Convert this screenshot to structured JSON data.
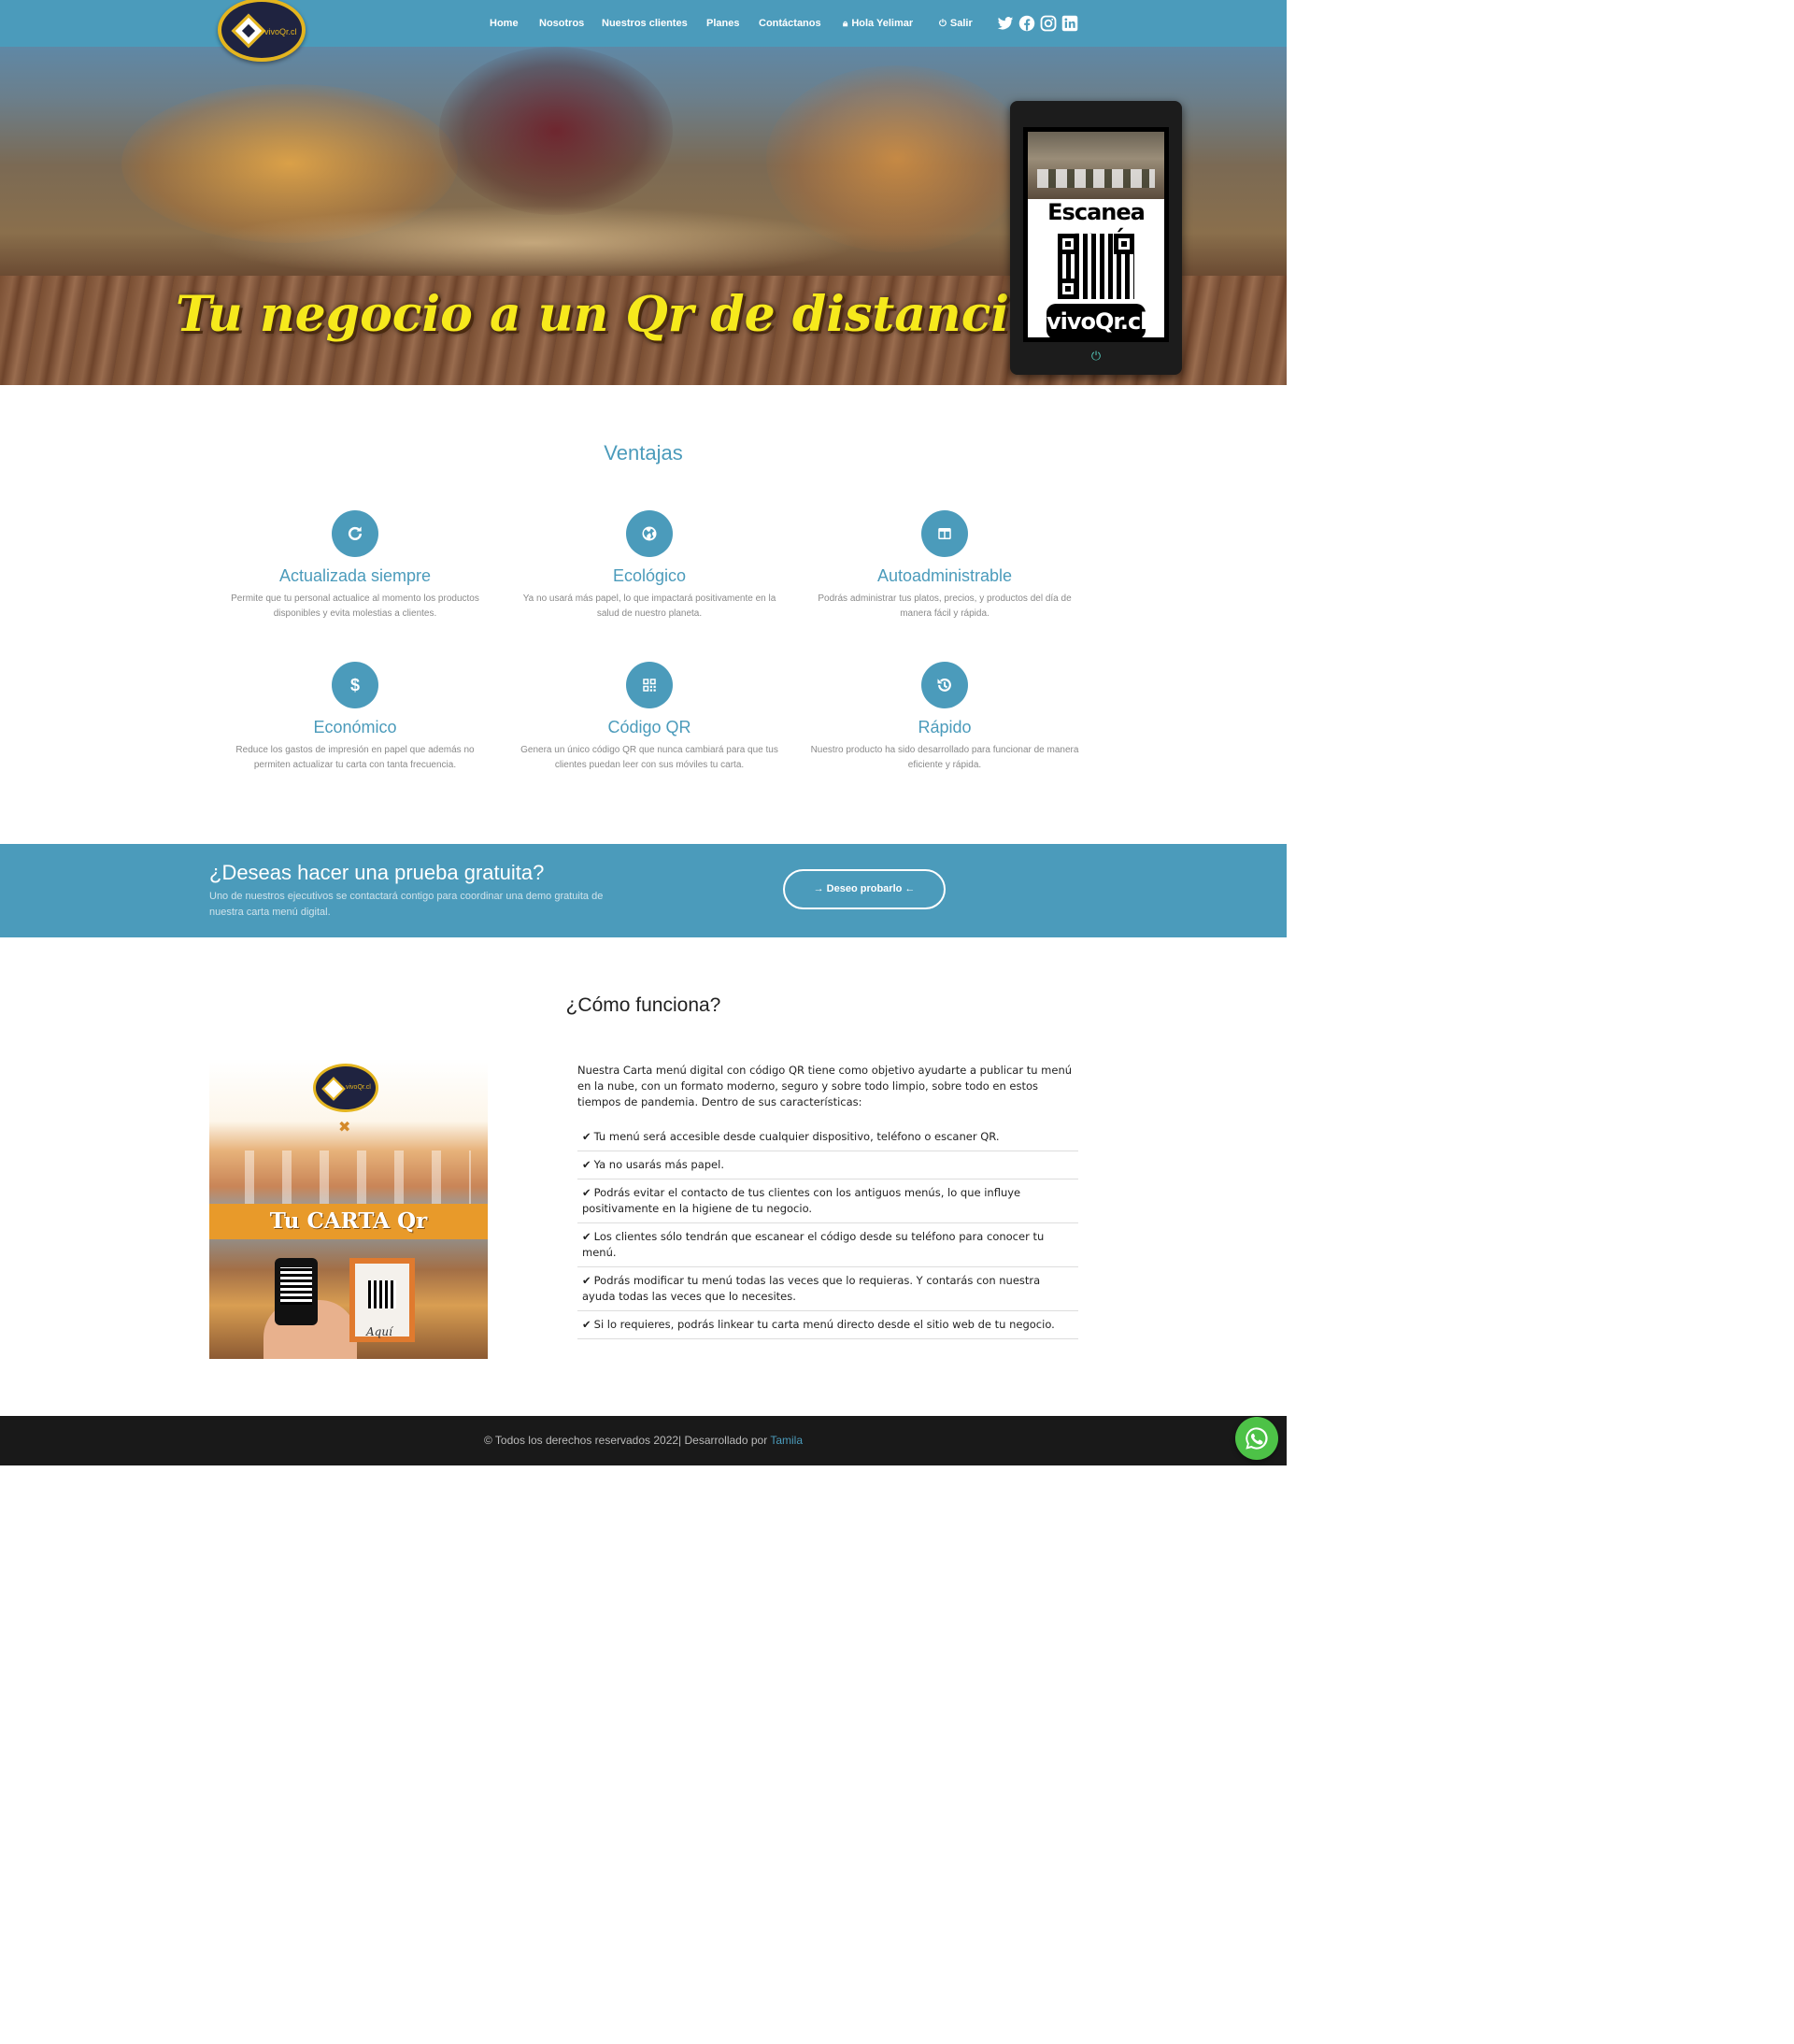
{
  "brand": {
    "logo_text": "vivoQr.cl"
  },
  "nav": {
    "home": "Home",
    "nosotros": "Nosotros",
    "clientes": "Nuestros clientes",
    "planes": "Planes",
    "contacto": "Contáctanos",
    "user": "Hola Yelimar",
    "logout": "Salir",
    "social": [
      "twitter-icon",
      "facebook-icon",
      "instagram-icon",
      "linkedin-icon"
    ]
  },
  "hero": {
    "title": "Tu negocio a un Qr de distancia",
    "tablet_scan": "Escanea aquí",
    "tablet_brand": "vivoQr.cl"
  },
  "ventajas": {
    "title": "Ventajas",
    "items": [
      {
        "icon": "refresh-icon",
        "title": "Actualizada siempre",
        "text": "Permite que tu personal actualice al momento los productos disponibles y evita molestias a clientes."
      },
      {
        "icon": "globe-icon",
        "title": "Ecológico",
        "text": "Ya no usará más papel, lo que impactará positivamente en la salud de nuestro planeta."
      },
      {
        "icon": "layout-icon",
        "title": "Autoadministrable",
        "text": "Podrás administrar tus platos, precios, y productos del día de manera fácil y rápida."
      },
      {
        "icon": "dollar-icon",
        "title": "Económico",
        "text": "Reduce los gastos de impresión en papel que además no permiten actualizar tu carta con tanta frecuencia."
      },
      {
        "icon": "qr-icon",
        "title": "Código QR",
        "text": "Genera un único código QR que nunca cambiará para que tus clientes puedan leer con sus móviles tu carta."
      },
      {
        "icon": "history-icon",
        "title": "Rápido",
        "text": "Nuestro producto ha sido desarrollado para funcionar de manera eficiente y rápida."
      }
    ]
  },
  "cta": {
    "title": "¿Deseas hacer una prueba gratuita?",
    "text": "Uno de nuestros ejecutivos se contactará contigo para coordinar una demo gratuita de nuestra carta menú digital.",
    "button": "Deseo probarlo"
  },
  "como": {
    "title": "¿Cómo funciona?",
    "image_banner": "Tu CARTA Qr",
    "image_stand": "Aquí",
    "intro": "Nuestra Carta menú digital con código QR tiene como objetivo ayudarte a publicar tu menú en la nube, con un formato moderno, seguro y sobre todo limpio, sobre todo en estos tiempos de pandemia. Dentro de sus características:",
    "items": [
      "Tu menú será accesible desde cualquier dispositivo, teléfono o escaner QR.",
      "Ya no usarás más papel.",
      "Podrás evitar el contacto de tus clientes con los antiguos menús, lo que influye positivamente en la higiene de tu negocio.",
      "Los clientes sólo tendrán que escanear el código desde su teléfono para conocer tu menú.",
      "Podrás modificar tu menú todas las veces que lo requieras. Y contarás con nuestra ayuda todas las veces que lo necesites.",
      "Si lo requieres, podrás linkear tu carta menú directo desde el sitio web de tu negocio."
    ]
  },
  "footer": {
    "text": "© Todos los derechos reservados 2022| Desarrollado por",
    "author": "Tamila"
  },
  "colors": {
    "primary": "#4b9bbb",
    "hero_title": "#f6e91c",
    "footer": "#191919",
    "whatsapp": "#4dc247"
  }
}
